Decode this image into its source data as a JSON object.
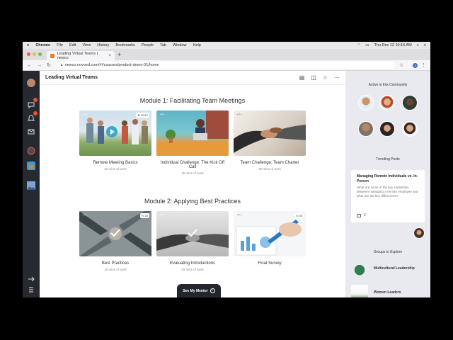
{
  "mac_menu": {
    "app": "Chrome",
    "items": [
      "File",
      "Edit",
      "View",
      "History",
      "Bookmarks",
      "People",
      "Tab",
      "Window",
      "Help"
    ],
    "clock": "Thu Dec 12  10:16 AM"
  },
  "browser": {
    "tab_title": "Leading Virtual Teams | newco",
    "url": "newco.novoed.com/#!/courses/product-demo-01/home"
  },
  "header": {
    "title": "Leading Virtual Teams"
  },
  "modules": [
    {
      "title": "Module 1: Facilitating Team Meetings",
      "cards": [
        {
          "name": "Remote Meeting Basics",
          "sub": "20 mins of work",
          "badge": "10/10"
        },
        {
          "name": "Individual Challenge: The Kick Off Call",
          "sub": "15 mins of work",
          "badge": ""
        },
        {
          "name": "Team Challenge: Team Charter",
          "sub": "30 mins of work",
          "badge": ""
        }
      ]
    },
    {
      "title": "Module 2: Applying Best Practices",
      "cards": [
        {
          "name": "Best Practices",
          "sub": "15 mins of work",
          "badge": "20"
        },
        {
          "name": "Evaluating Introductions",
          "sub": "20 mins of work",
          "badge": ""
        },
        {
          "name": "Final Survey",
          "sub": "",
          "badge": "30"
        }
      ]
    }
  ],
  "mentor_button": "See My Mentor",
  "community": {
    "active_title": "Active in this Community",
    "trending_title": "Trending Posts",
    "post": {
      "title": "Managing Remote Individuals vs. In-Person",
      "body": "What are some of the key similarities between managing a remote employee and what are the key differences?",
      "comments": "2"
    },
    "groups_title": "Groups to Explore",
    "groups": [
      "Multicultural Leadership",
      "Women Leaders"
    ]
  },
  "colors": {
    "sidebar": "#262930",
    "panel": "#e8eaf0",
    "badge": "#e4572e",
    "accent_orange": "#e97e25"
  }
}
